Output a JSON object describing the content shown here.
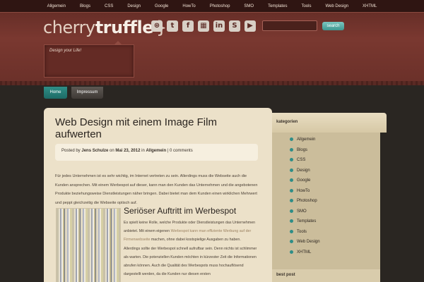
{
  "top_nav": [
    "Allgemein",
    "Blogs",
    "CSS",
    "Design",
    "Google",
    "HowTo",
    "Photoshop",
    "SMO",
    "Templates",
    "Tools",
    "Web Design",
    "XHTML"
  ],
  "logo": {
    "cherry": "cherry",
    "truffle": "truffle",
    "brace": "}"
  },
  "social_icons": [
    "rss-icon",
    "twitter-icon",
    "facebook-icon",
    "delicious-icon",
    "linkedin-icon",
    "stumbleupon-icon",
    "youtube-icon"
  ],
  "search": {
    "button": "search",
    "placeholder": ""
  },
  "tagline": "Design your Life!",
  "page_nav": {
    "home": "Home",
    "impressum": "Impressum"
  },
  "post": {
    "title": "Web Design mit einem Image Film aufwerten",
    "meta": {
      "posted_by": "Posted by",
      "author": "Jens Schulze",
      "on": "on",
      "date": "Mai 23, 2012",
      "in": "in",
      "category": "Allgemein",
      "sep": "|",
      "comments": "0 comments"
    },
    "intro": "Für jedes Unternehmen ist es sehr wichtig, im Internet vertreten zu sein. Allerdings muss die Webseite auch die Kunden ansprechen. Mit einem Werbespot auf dieser, kann man den Kunden das Unternehmen und die angebotenen Produkte beziehungsweise Dienstleistungen näher bringen. Dabei bietet man dem Kunden einen wirklichen Mehrwert und peppt gleichzeitig die Webseite optisch auf.",
    "subheading": "Seriöser Auftritt im Werbespot",
    "body_1": "Es spielt keine Rolle, welche Produkte oder Dienstleistungen das Unternehmen anbietet. Mit einem eigenen ",
    "body_link": "Werbespot kann man effiziente Werbung auf der Firmenwebseite",
    "body_2": " machen, ohne dabei kostspielige Ausgaben zu haben. Allerdings sollte der Werbespot schnell aufrufbar sein. Denn nichts ist schlimmer als warten. Die potenziellen Kunden möchten in kürzester Zeit die Informationen abrufen können. Auch die Qualität des Werbespots muss hochauflösend dargestellt werden, da die Kunden nur diesen ersten"
  },
  "sidebar": {
    "title": "kategorien",
    "categories": [
      "Allgemein",
      "Blogs",
      "CSS",
      "Design",
      "Google",
      "HowTo",
      "Photoshop",
      "SMO",
      "Templates",
      "Tools",
      "Web Design",
      "XHTML"
    ],
    "best_post_title": "best post"
  },
  "colors": {
    "accent": "#2f8e87",
    "header": "#7a3830",
    "content_bg": "#ece1c9"
  }
}
